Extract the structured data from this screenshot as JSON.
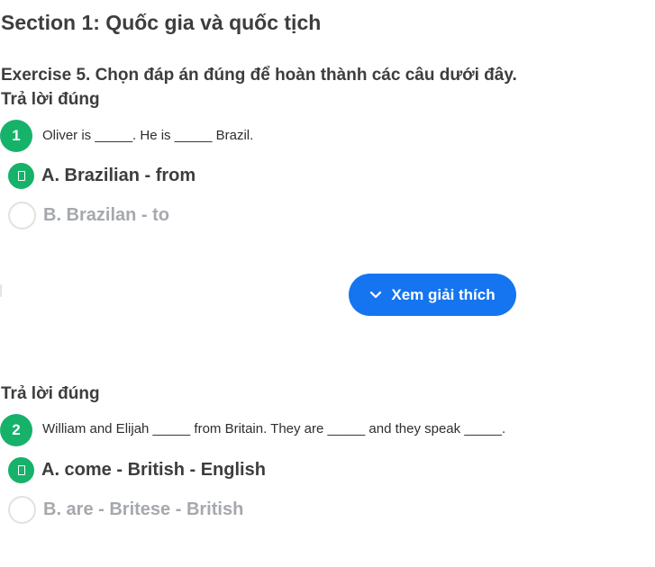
{
  "section": {
    "title": "Section 1: Quốc gia và quốc tịch"
  },
  "exercise": {
    "title": "Exercise 5. Chọn đáp án đúng để hoàn thành các câu dưới đây."
  },
  "questions": [
    {
      "status": "Trả lời đúng",
      "number": "1",
      "text": "Oliver is _____. He is _____ Brazil.",
      "options": [
        {
          "label": "A. Brazilian - from",
          "selected": true
        },
        {
          "label": "B. Brazilan - to",
          "selected": false
        }
      ],
      "explain_label": "Xem giải thích"
    },
    {
      "status": "Trả lời đúng",
      "number": "2",
      "text": "William and Elijah _____ from Britain. They are _____ and they speak _____.",
      "options": [
        {
          "label": "A. come - British - English",
          "selected": true
        },
        {
          "label": "B. are - Britese - British",
          "selected": false
        }
      ]
    }
  ],
  "colors": {
    "correct_green": "#17b26a",
    "button_blue": "#1575f0",
    "muted_text": "#a5a8ad"
  },
  "icons": {
    "selected_option": "check-icon",
    "explain_button": "chevron-down-icon"
  }
}
